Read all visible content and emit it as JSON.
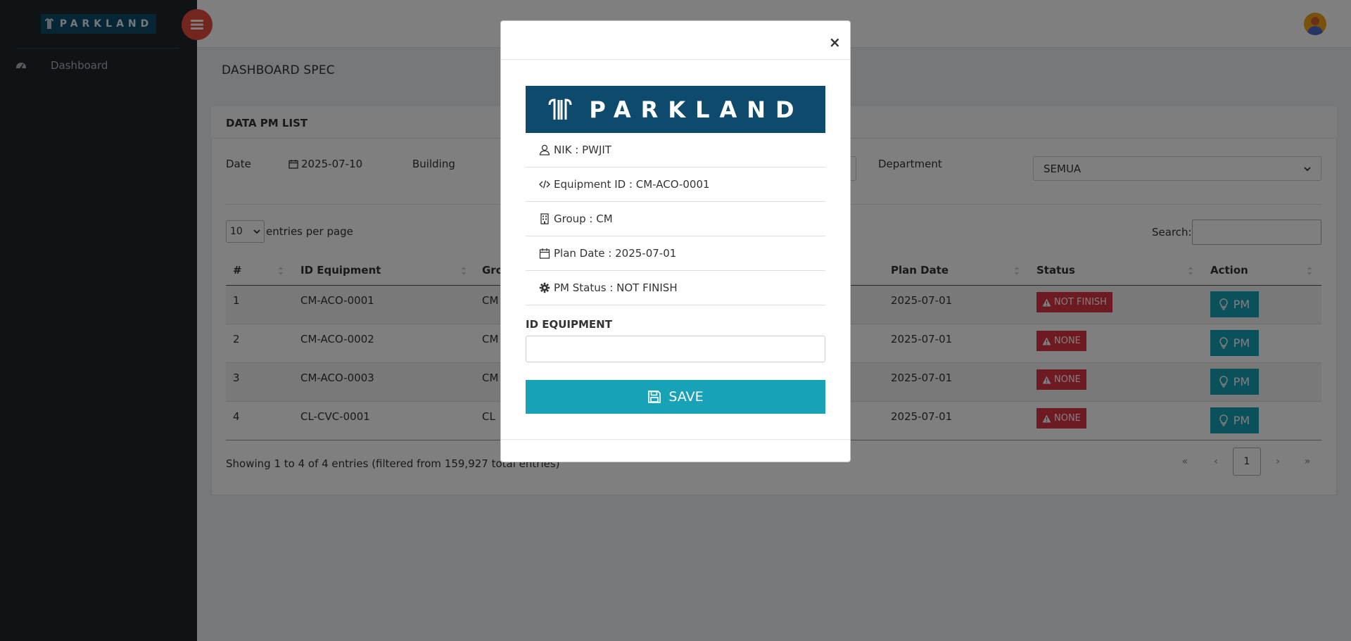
{
  "sidebar": {
    "logo_text": "PARKLAND",
    "items": [
      {
        "label": "Dashboard",
        "icon": "dashboard-icon"
      }
    ]
  },
  "page": {
    "title": "DASHBOARD SPEC"
  },
  "card": {
    "title": "DATA PM LIST"
  },
  "filters": {
    "date_label": "Date",
    "date_value": "2025-07-10",
    "building_label": "Building",
    "department_label": "Department",
    "department_value": "SEMUA"
  },
  "table_controls": {
    "entries_value": "10",
    "entries_text": "entries per page",
    "search_label": "Search:",
    "search_value": ""
  },
  "table": {
    "columns": [
      "#",
      "ID Equipment",
      "Gro",
      "Plan Date",
      "Status",
      "Action"
    ],
    "rows": [
      {
        "num": "1",
        "id": "CM-ACO-0001",
        "group": "CM",
        "plan_date": "2025-07-01",
        "status": "NOT FINISH",
        "action": "PM"
      },
      {
        "num": "2",
        "id": "CM-ACO-0002",
        "group": "CM",
        "plan_date": "2025-07-01",
        "status": "NONE",
        "action": "PM"
      },
      {
        "num": "3",
        "id": "CM-ACO-0003",
        "group": "CM",
        "plan_date": "2025-07-01",
        "status": "NONE",
        "action": "PM"
      },
      {
        "num": "4",
        "id": "CL-CVC-0001",
        "group": "CL",
        "plan_date": "2025-07-01",
        "status": "NONE",
        "action": "PM"
      }
    ],
    "showing": "Showing 1 to 4 of 4 entries (filtered from 159,927 total entries)"
  },
  "pagination": {
    "first": "«",
    "prev": "‹",
    "current": "1",
    "next": "›",
    "last": "»"
  },
  "modal": {
    "close": "×",
    "brand_text": "PARKLAND",
    "nik": "NIK : PWJIT",
    "equipment_id": "Equipment ID : CM-ACO-0001",
    "group": "Group : CM",
    "plan_date": "Plan Date : 2025-07-01",
    "pm_status": "PM Status : NOT FINISH",
    "field_label": "ID EQUIPMENT",
    "field_value": "",
    "save_label": "SAVE"
  },
  "colors": {
    "sidebar_bg": "#1f262d",
    "brand_blue": "#0d4a6b",
    "info_teal": "#17a2b8",
    "danger_red": "#dc3545",
    "hamburger_red": "#e74c3c"
  }
}
